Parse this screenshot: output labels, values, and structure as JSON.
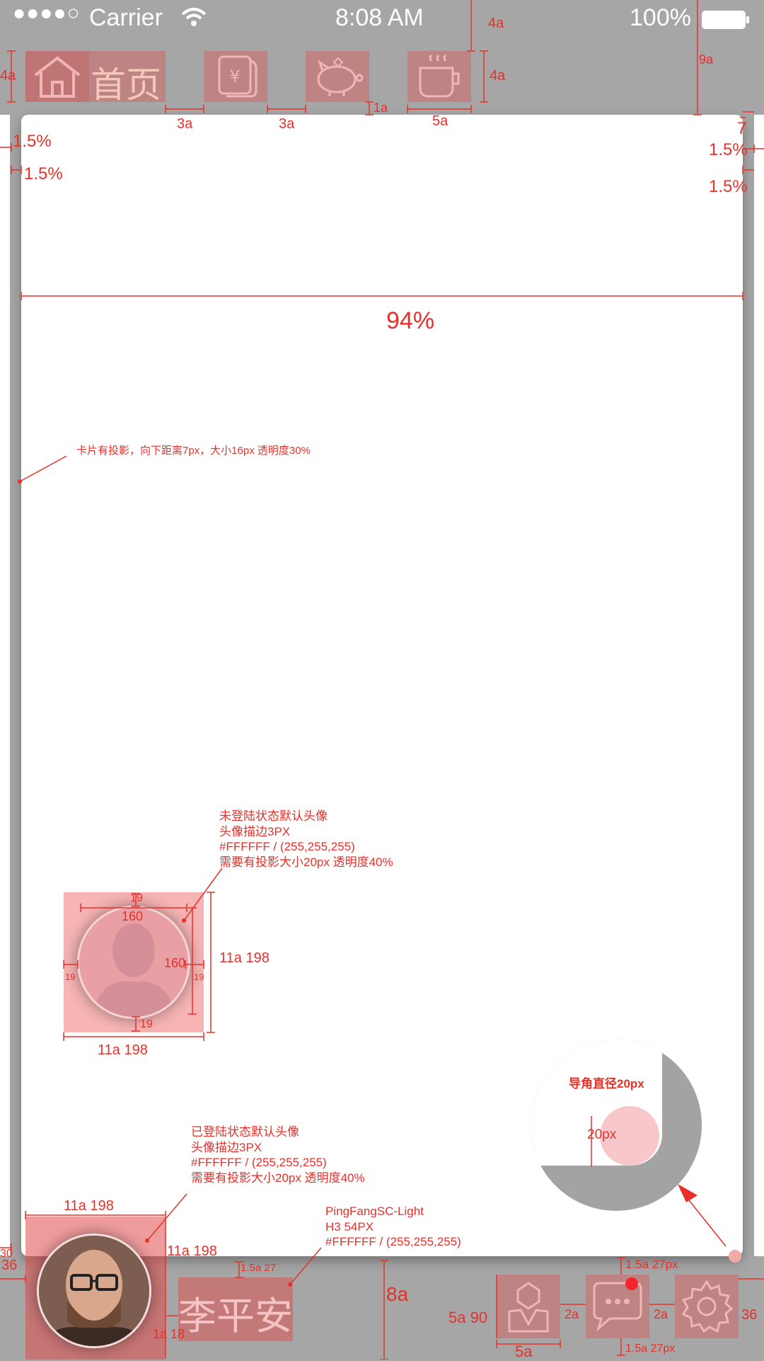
{
  "status_bar": {
    "carrier": "Carrier",
    "time": "8:08 AM",
    "battery": "100%"
  },
  "top_nav": {
    "home_label": "首页",
    "icons": [
      "home-icon",
      "money-icon",
      "piggy-bank-icon",
      "coffee-icon"
    ]
  },
  "dims": {
    "top_4a": "4a",
    "top_9a": "9a",
    "left_4a": "4a",
    "right_4a": "4a",
    "gap_3a_1": "3a",
    "gap_3a_2": "3a",
    "gap_1a": "1a",
    "icon_5a": "5a",
    "left_pct_1": "1.5%",
    "left_pct_2": "1.5%",
    "right_7": "7",
    "right_pct_1": "1.5%",
    "right_pct_2": "1.5%",
    "card_width": "94%",
    "avatar_19_top": "19",
    "avatar_160_w": "160",
    "avatar_160_h": "160",
    "avatar_19_left": "19",
    "avatar_19_right": "19",
    "avatar_19_bottom": "19",
    "avatar_side": "11a 198",
    "avatar_bottom": "11a 198",
    "logged_top": "11a 198",
    "logged_right": "11a 198",
    "name_gap": "1.5a 27",
    "name_side": "1a 18",
    "bottom_8a": "8a",
    "left_30": "30",
    "left_36": "36",
    "right_36": "36",
    "icon_5a_90": "5a 90",
    "icon_5a_bottom": "5a",
    "gap_2a_1": "2a",
    "gap_2a_2": "2a",
    "top_15a": "1.5a 27px",
    "bottom_15a": "1.5a 27px",
    "radius_label": "导角直径20px",
    "radius_value": "20px"
  },
  "notes": {
    "card_shadow": "卡片有投影，向下距离7px，大小16px 透明度30%",
    "guest_avatar": [
      "未登陆状态默认头像",
      "头像描边3PX",
      "#FFFFFF / (255,255,255)",
      "需要有投影大小20px 透明度40%"
    ],
    "user_avatar": [
      "已登陆状态默认头像",
      "头像描边3PX",
      "#FFFFFF / (255,255,255)",
      "需要有投影大小20px 透明度40%"
    ],
    "font_spec": [
      "PingFangSC-Light",
      "H3 54PX",
      "#FFFFFF / (255,255,255)"
    ]
  },
  "user": {
    "name": "李平安"
  },
  "bottom_icons": [
    "profile-icon",
    "chat-icon",
    "settings-icon"
  ],
  "colors": {
    "background": "#a6a6a6",
    "card": "#ffffff",
    "annotation": "#e8302a",
    "highlight": "#e85a5a"
  }
}
